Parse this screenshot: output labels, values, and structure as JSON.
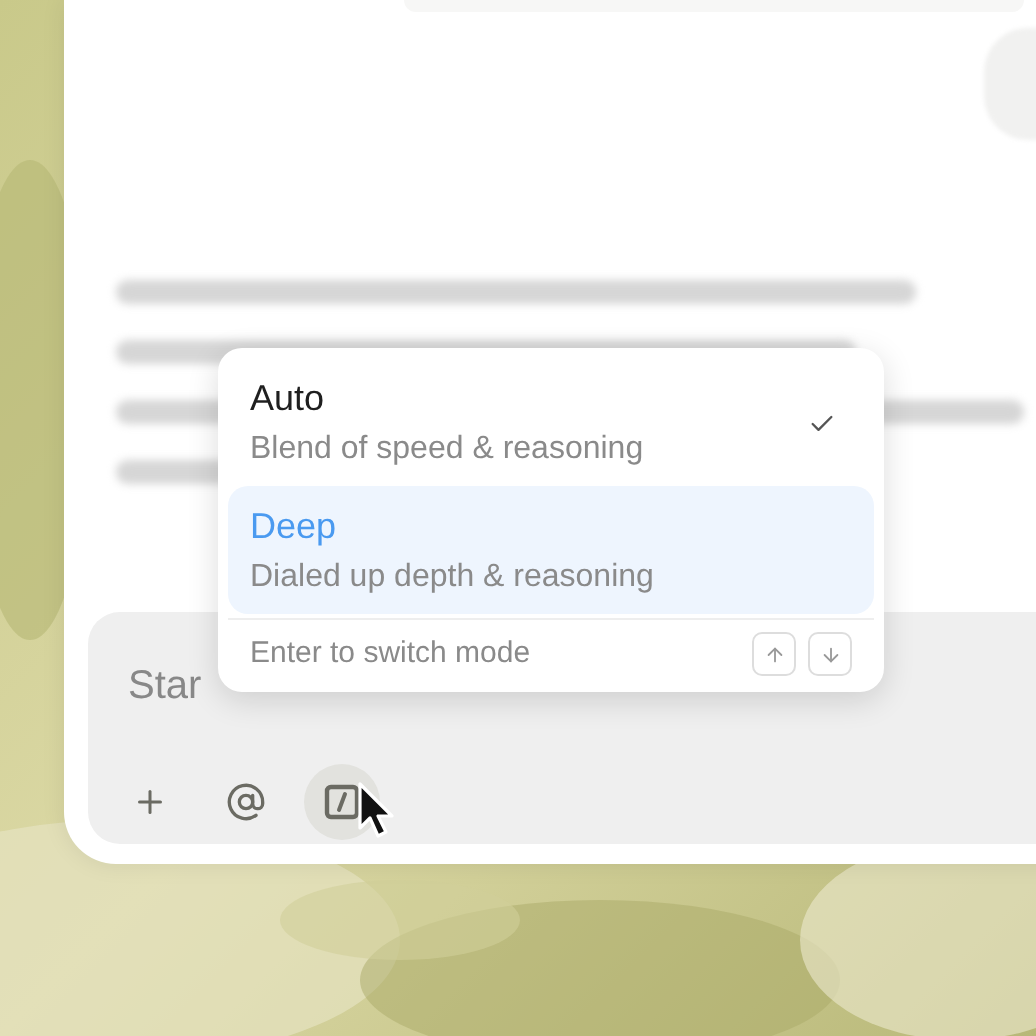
{
  "composer": {
    "placeholder": "Star"
  },
  "mode_menu": {
    "options": [
      {
        "title": "Auto",
        "subtitle": "Blend of speed & reasoning",
        "selected": false,
        "checked": true
      },
      {
        "title": "Deep",
        "subtitle": "Dialed up depth & reasoning",
        "selected": true,
        "checked": false
      }
    ],
    "hint": "Enter to switch mode"
  },
  "toolbar": [
    {
      "kind": "plus",
      "active": false
    },
    {
      "kind": "mention",
      "active": false
    },
    {
      "kind": "command",
      "active": true
    }
  ]
}
